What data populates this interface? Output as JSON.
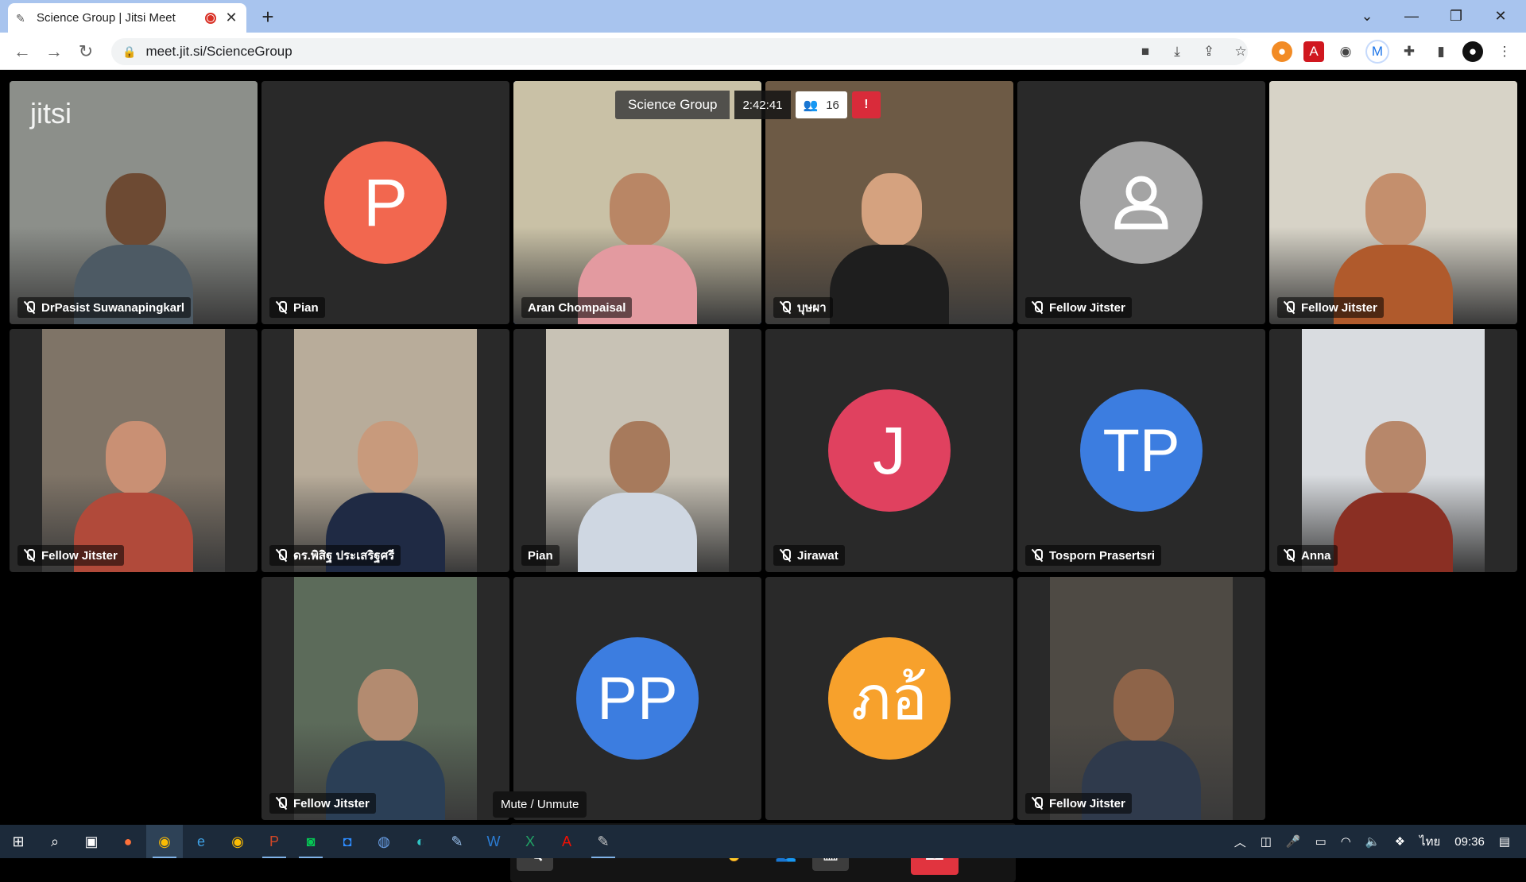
{
  "browser": {
    "tab_title": "Science Group | Jitsi Meet",
    "url": "meet.jit.si/ScienceGroup",
    "new_tab_glyph": "+",
    "close_glyph": "✕"
  },
  "meeting": {
    "logo": "jitsi",
    "conference_name": "Science Group",
    "duration": "2:42:41",
    "participant_count": "16",
    "warning_glyph": "!"
  },
  "tiles": [
    {
      "name": "DrPasist Suwanapingkarl",
      "type": "video",
      "bg": "#8c8f8a",
      "skin": "#6d4a33",
      "shirt": "#4d5a64",
      "logo": true
    },
    {
      "name": "Pian",
      "type": "avatar",
      "initials": "P",
      "color": "#f2674f"
    },
    {
      "name": "Aran Chompaisal",
      "type": "video",
      "bg": "#c9c1a6",
      "skin": "#b98665",
      "shirt": "#e39aa0",
      "active": true
    },
    {
      "name": "บุษผา",
      "type": "video",
      "bg": "#6d5a45",
      "skin": "#d5a27f",
      "shirt": "#1e1e1e"
    },
    {
      "name": "Fellow Jitster",
      "type": "generic"
    },
    {
      "name": "Fellow Jitster",
      "type": "video",
      "bg": "#d7d3c7",
      "skin": "#c48f6d",
      "shirt": "#b05a2c"
    },
    {
      "name": "Fellow Jitster",
      "type": "video",
      "bg": "#7f7467",
      "skin": "#c99074",
      "shirt": "#b14a3a",
      "narrow": true
    },
    {
      "name": "ดร.พิสิฐ ประเสริฐศรี",
      "type": "video",
      "bg": "#b8ac9a",
      "skin": "#c89a7c",
      "shirt": "#1f2a44",
      "narrow": true
    },
    {
      "name": "Pian",
      "type": "video",
      "bg": "#c8c2b5",
      "skin": "#a77a5c",
      "shirt": "#cfd7e2",
      "narrow": true
    },
    {
      "name": "Jirawat",
      "type": "avatar",
      "initials": "J",
      "color": "#e0415f"
    },
    {
      "name": "Tosporn Prasertsri",
      "type": "avatar",
      "initials": "TP",
      "color": "#3c7de0"
    },
    {
      "name": "Anna",
      "type": "video",
      "bg": "#d9dce0",
      "skin": "#b7876a",
      "shirt": "#8a2f23",
      "narrow": true
    },
    {
      "name": "Fellow Jitster",
      "type": "video",
      "bg": "#5c6b5a",
      "skin": "#b38b70",
      "shirt": "#2b3f56",
      "narrow": true
    },
    {
      "name": "",
      "type": "avatar",
      "initials": "PP",
      "color": "#3c7de0"
    },
    {
      "name": "",
      "type": "avatar",
      "initials": "ภอ้",
      "color": "#f7a12c"
    },
    {
      "name": "Fellow Jitster",
      "type": "video",
      "bg": "#4e4a44",
      "skin": "#8e6449",
      "shirt": "#2f3a4c",
      "narrow": true
    }
  ],
  "toolbox": {
    "tooltip": "Mute / Unmute",
    "buttons": [
      "microphone",
      "camera",
      "share-screen",
      "chat",
      "raise-hand",
      "participants",
      "tile-view",
      "more"
    ]
  },
  "taskbar": {
    "language": "ไทย",
    "time": "09:36"
  }
}
